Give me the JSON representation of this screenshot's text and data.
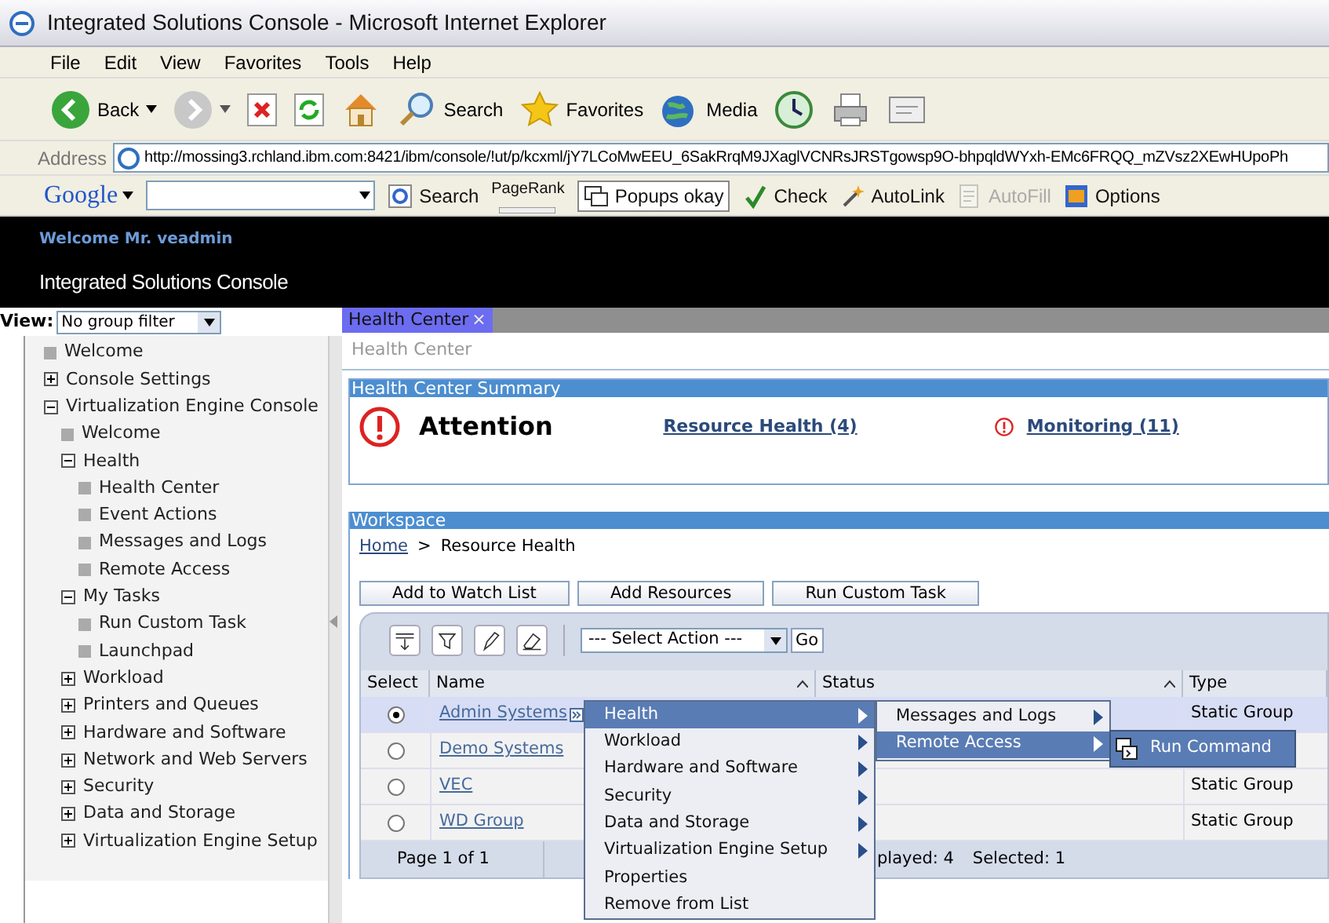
{
  "window": {
    "title": "Integrated Solutions Console - Microsoft Internet Explorer"
  },
  "menu_bar": [
    "File",
    "Edit",
    "View",
    "Favorites",
    "Tools",
    "Help"
  ],
  "toolbar": [
    {
      "kind": "back",
      "label": "Back"
    },
    {
      "kind": "forward"
    },
    {
      "kind": "stop"
    },
    {
      "kind": "refresh"
    },
    {
      "kind": "home"
    },
    {
      "kind": "search",
      "label": "Search"
    },
    {
      "kind": "favorites",
      "label": "Favorites"
    },
    {
      "kind": "media",
      "label": "Media"
    },
    {
      "kind": "history"
    },
    {
      "kind": "print"
    },
    {
      "kind": "edit"
    }
  ],
  "address": {
    "label": "Address",
    "url": "http://mossing3.rchland.ibm.com:8421/ibm/console/!ut/p/kcxml/jY7LCoMwEEU_6SakRrqM9JXaglVCNRsJRSTgowsp9O-bhpqldWYxh-EMc6FRQQ_mZVsz2XEwHUpoPh"
  },
  "google_bar": {
    "logo": "Google",
    "items": [
      {
        "kind": "search",
        "label": "Search",
        "disabled": false
      },
      {
        "kind": "pagerank",
        "label": "PageRank",
        "disabled": false
      },
      {
        "kind": "popups",
        "label": "Popups okay",
        "disabled": false
      },
      {
        "kind": "check",
        "label": "Check",
        "disabled": false
      },
      {
        "kind": "autolink",
        "label": "AutoLink",
        "disabled": false
      },
      {
        "kind": "autofill",
        "label": "AutoFill",
        "disabled": true
      },
      {
        "kind": "options",
        "label": "Options",
        "disabled": false
      }
    ]
  },
  "header": {
    "welcome": "Welcome Mr. veadmin",
    "title": "Integrated Solutions Console"
  },
  "sidebar": {
    "view_label": "View:",
    "filter": "No group filter",
    "tree": [
      {
        "kind": "page",
        "label": "Welcome"
      },
      {
        "kind": "folder",
        "label": "Console Settings",
        "expanded": false
      },
      {
        "kind": "folder",
        "label": "Virtualization Engine Console",
        "expanded": true,
        "children": [
          {
            "kind": "page",
            "label": "Welcome"
          },
          {
            "kind": "folder",
            "label": "Health",
            "expanded": true,
            "children": [
              {
                "kind": "page",
                "label": "Health Center"
              },
              {
                "kind": "page",
                "label": "Event Actions"
              },
              {
                "kind": "page",
                "label": "Messages and Logs"
              },
              {
                "kind": "page",
                "label": "Remote Access"
              }
            ]
          },
          {
            "kind": "folder",
            "label": "My Tasks",
            "expanded": true,
            "children": [
              {
                "kind": "page",
                "label": "Run Custom Task"
              },
              {
                "kind": "page",
                "label": "Launchpad"
              }
            ]
          },
          {
            "kind": "folder",
            "label": "Workload",
            "expanded": false
          },
          {
            "kind": "folder",
            "label": "Printers and Queues",
            "expanded": false
          },
          {
            "kind": "folder",
            "label": "Hardware and Software",
            "expanded": false
          },
          {
            "kind": "folder",
            "label": "Network and Web Servers",
            "expanded": false
          },
          {
            "kind": "folder",
            "label": "Security",
            "expanded": false
          },
          {
            "kind": "folder",
            "label": "Data and Storage",
            "expanded": false
          },
          {
            "kind": "folder",
            "label": "Virtualization Engine Setup",
            "expanded": false
          }
        ]
      }
    ]
  },
  "tabs": [
    {
      "label": "Health Center",
      "close": "×",
      "selected": true
    }
  ],
  "page_title": "Health Center",
  "summary": {
    "header": "Health Center Summary",
    "status": "Attention",
    "links": [
      {
        "label": "Resource Health (4)",
        "alert": false
      },
      {
        "label": "Monitoring (11)",
        "alert": true
      }
    ]
  },
  "workspace": {
    "header": "Workspace",
    "breadcrumb_home": "Home",
    "separator": ">",
    "breadcrumb_current": "Resource Health"
  },
  "buttons": [
    "Add to Watch List",
    "Add Resources",
    "Run Custom Task"
  ],
  "table_tools": {
    "icons": [
      {
        "kind": "expand"
      },
      {
        "kind": "filter"
      },
      {
        "kind": "edit"
      },
      {
        "kind": "clear"
      }
    ],
    "select_action": "--- Select Action ---",
    "go": "Go"
  },
  "table": {
    "columns": [
      "Select",
      "Name",
      "Status",
      "Type"
    ],
    "rows": [
      {
        "name": "Admin Systems",
        "selected": true,
        "type": "Static Group"
      },
      {
        "name": "Demo Systems",
        "selected": false
      },
      {
        "name": "VEC",
        "selected": false,
        "type": "Static Group"
      },
      {
        "name": "WD Group",
        "selected": false,
        "type": "Static Group"
      }
    ],
    "page": "Page 1 of 1",
    "displayed": "played: 4",
    "selected_count": "Selected: 1"
  },
  "context_menu": [
    {
      "label": "Health",
      "submenu": true,
      "selected": true
    },
    {
      "label": "Workload",
      "submenu": true,
      "selected": false
    },
    {
      "label": "Hardware and Software",
      "submenu": true,
      "selected": false
    },
    {
      "label": "Security",
      "submenu": true,
      "selected": false
    },
    {
      "label": "Data and Storage",
      "submenu": true,
      "selected": false
    },
    {
      "label": "Virtualization Engine Setup",
      "submenu": true,
      "selected": false
    },
    {
      "label": "Properties",
      "submenu": false,
      "selected": false
    },
    {
      "label": "Remove from List",
      "submenu": false,
      "selected": false
    }
  ],
  "submenu": [
    {
      "label": "Messages and Logs",
      "submenu": true,
      "selected": false
    },
    {
      "label": "Remote Access",
      "submenu": true,
      "selected": true
    }
  ],
  "submenu_2": [
    {
      "label": "Run Command",
      "selected": true
    }
  ]
}
